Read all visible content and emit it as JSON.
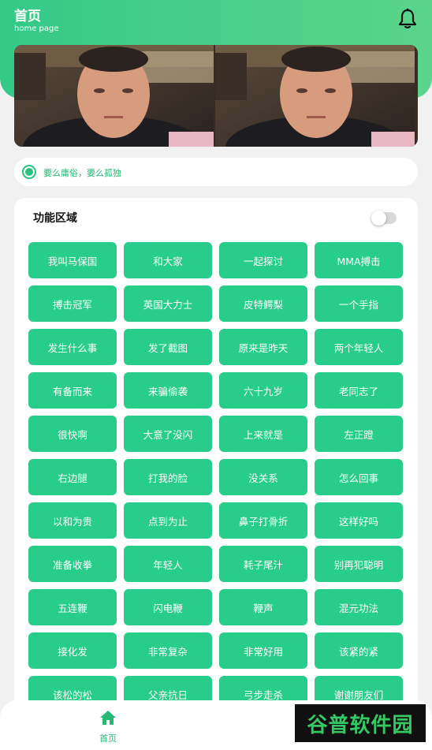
{
  "header": {
    "title": "首页",
    "subtitle": "home page",
    "bell_icon": "bell-icon"
  },
  "banner": {
    "image_description": "banner-photo"
  },
  "notice": {
    "text": "要么庸俗，要么孤独"
  },
  "panel": {
    "title": "功能区域",
    "toggle_on": false,
    "buttons": [
      "我叫马保国",
      "和大家",
      "一起探讨",
      "MMA搏击",
      "搏击冠军",
      "英国大力士",
      "皮特鳄梨",
      "一个手指",
      "发生什么事",
      "发了截图",
      "原来是昨天",
      "两个年轻人",
      "有备而来",
      "来骗偷袭",
      "六十九岁",
      "老同志了",
      "很快啊",
      "大意了没闪",
      "上来就是",
      "左正蹬",
      "右边腿",
      "打我的脸",
      "没关系",
      "怎么回事",
      "以和为贵",
      "点到为止",
      "鼻子打骨折",
      "这样好吗",
      "准备收拳",
      "年轻人",
      "耗子尾汁",
      "别再犯聪明",
      "五连鞭",
      "闪电鞭",
      "鞭声",
      "混元功法",
      "接化发",
      "非常复杂",
      "非常好用",
      "该紧的紧",
      "该松的松",
      "父亲抗日",
      "弓步走杀",
      "谢谢朋友们"
    ]
  },
  "tabbar": {
    "home_label": "首页",
    "home_icon": "home-icon"
  },
  "watermark": {
    "text": "谷普软件园"
  },
  "colors": {
    "primary": "#27cd89",
    "header_gradient_start": "#34c988",
    "header_gradient_end": "#5bd48a"
  }
}
